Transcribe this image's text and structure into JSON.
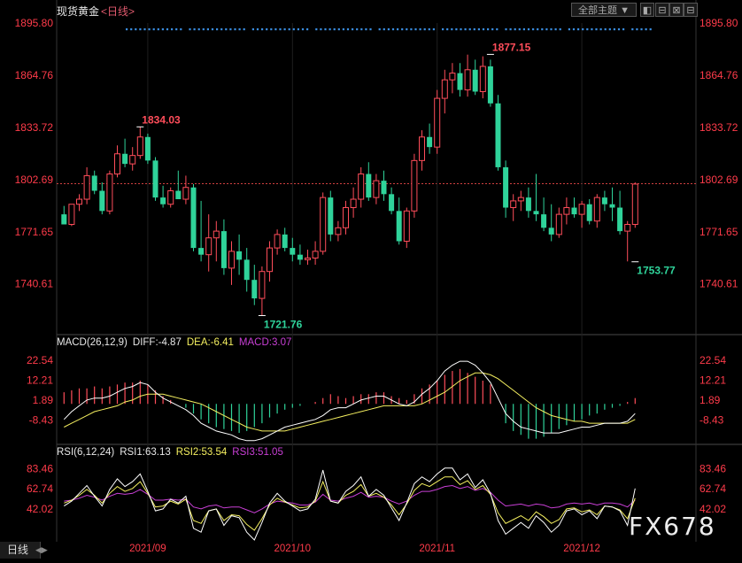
{
  "header": {
    "title": "现货黄金",
    "period": "<日线>",
    "theme_button": "全部主题",
    "theme_arrow": "▼",
    "window_buttons": [
      "◧",
      "⊟",
      "⊠",
      "⊟"
    ]
  },
  "bottom_tab": {
    "label": "日线",
    "arrows": "◀▶"
  },
  "watermark": "FX678",
  "colors": {
    "up": "#ff4d5a",
    "down": "#2fd39a",
    "axis": "#ff3b4a",
    "diff": "#ffffff",
    "dea": "#f5f060",
    "macd_legend": "#c93fd6",
    "rsi1": "#ffffff",
    "rsi2": "#f5f060",
    "rsi3": "#c93fd6",
    "dots": "#3a8de0"
  },
  "chart_data": [
    {
      "type": "candlestick",
      "title": "现货黄金",
      "y_ticks": [
        "1895.80",
        "1864.76",
        "1833.72",
        "1802.69",
        "1771.65",
        "1740.61"
      ],
      "ylim": [
        1711.5,
        1895.8
      ],
      "current_price_line": 1800.2,
      "x_ticks": [
        "2021/09",
        "2021/10",
        "2021/11",
        "2021/12"
      ],
      "x_tick_candle_index": [
        11,
        30,
        49,
        68
      ],
      "annotations": [
        {
          "text": "1834.03",
          "candle_index": 10,
          "value": 1834.03,
          "color": "up"
        },
        {
          "text": "1877.15",
          "candle_index": 56,
          "value": 1877.15,
          "color": "up"
        },
        {
          "text": "1721.76",
          "candle_index": 26,
          "value": 1721.76,
          "color": "down"
        },
        {
          "text": "1753.77",
          "candle_index": 75,
          "value": 1753.77,
          "color": "down"
        }
      ],
      "candles": [
        [
          1782,
          1787,
          1776,
          1776
        ],
        [
          1776,
          1788,
          1775,
          1788
        ],
        [
          1788,
          1794,
          1784,
          1791
        ],
        [
          1791,
          1810,
          1788,
          1805
        ],
        [
          1805,
          1808,
          1794,
          1796
        ],
        [
          1796,
          1801,
          1782,
          1784
        ],
        [
          1784,
          1808,
          1782,
          1806
        ],
        [
          1806,
          1823,
          1804,
          1818
        ],
        [
          1818,
          1827,
          1810,
          1812
        ],
        [
          1812,
          1822,
          1808,
          1817
        ],
        [
          1817,
          1834,
          1815,
          1828
        ],
        [
          1828,
          1830,
          1812,
          1814
        ],
        [
          1814,
          1816,
          1790,
          1792
        ],
        [
          1792,
          1799,
          1786,
          1788
        ],
        [
          1788,
          1798,
          1786,
          1796
        ],
        [
          1796,
          1808,
          1793,
          1791
        ],
        [
          1791,
          1805,
          1788,
          1798
        ],
        [
          1798,
          1800,
          1760,
          1762
        ],
        [
          1762,
          1790,
          1754,
          1758
        ],
        [
          1758,
          1782,
          1748,
          1768
        ],
        [
          1768,
          1778,
          1754,
          1772
        ],
        [
          1772,
          1779,
          1746,
          1750
        ],
        [
          1750,
          1766,
          1740,
          1760
        ],
        [
          1760,
          1770,
          1746,
          1755
        ],
        [
          1755,
          1762,
          1736,
          1743
        ],
        [
          1743,
          1752,
          1728,
          1732
        ],
        [
          1732,
          1751,
          1722,
          1748
        ],
        [
          1748,
          1766,
          1742,
          1762
        ],
        [
          1762,
          1773,
          1758,
          1770
        ],
        [
          1770,
          1774,
          1760,
          1762
        ],
        [
          1762,
          1768,
          1754,
          1758
        ],
        [
          1758,
          1764,
          1752,
          1755
        ],
        [
          1755,
          1761,
          1752,
          1756
        ],
        [
          1756,
          1766,
          1752,
          1760
        ],
        [
          1760,
          1795,
          1758,
          1792
        ],
        [
          1792,
          1796,
          1766,
          1770
        ],
        [
          1770,
          1778,
          1766,
          1774
        ],
        [
          1774,
          1790,
          1770,
          1786
        ],
        [
          1786,
          1798,
          1780,
          1791
        ],
        [
          1791,
          1810,
          1786,
          1806
        ],
        [
          1806,
          1813,
          1790,
          1792
        ],
        [
          1792,
          1806,
          1788,
          1802
        ],
        [
          1802,
          1808,
          1790,
          1794
        ],
        [
          1794,
          1798,
          1782,
          1784
        ],
        [
          1784,
          1792,
          1764,
          1766
        ],
        [
          1766,
          1786,
          1762,
          1784
        ],
        [
          1784,
          1818,
          1780,
          1814
        ],
        [
          1814,
          1832,
          1808,
          1828
        ],
        [
          1828,
          1836,
          1818,
          1822
        ],
        [
          1822,
          1856,
          1818,
          1851
        ],
        [
          1851,
          1868,
          1842,
          1862
        ],
        [
          1862,
          1872,
          1854,
          1866
        ],
        [
          1866,
          1872,
          1852,
          1856
        ],
        [
          1856,
          1877,
          1852,
          1868
        ],
        [
          1868,
          1874,
          1853,
          1855
        ],
        [
          1855,
          1876,
          1851,
          1870
        ],
        [
          1870,
          1874,
          1846,
          1848
        ],
        [
          1848,
          1853,
          1808,
          1810
        ],
        [
          1810,
          1814,
          1780,
          1786
        ],
        [
          1786,
          1794,
          1778,
          1790
        ],
        [
          1790,
          1796,
          1784,
          1792
        ],
        [
          1792,
          1798,
          1780,
          1784
        ],
        [
          1784,
          1806,
          1778,
          1782
        ],
        [
          1782,
          1792,
          1772,
          1774
        ],
        [
          1774,
          1788,
          1766,
          1770
        ],
        [
          1770,
          1786,
          1768,
          1782
        ],
        [
          1782,
          1792,
          1776,
          1786
        ],
        [
          1786,
          1792,
          1780,
          1782
        ],
        [
          1782,
          1790,
          1774,
          1788
        ],
        [
          1788,
          1791,
          1776,
          1778
        ],
        [
          1778,
          1794,
          1774,
          1792
        ],
        [
          1792,
          1796,
          1784,
          1788
        ],
        [
          1788,
          1798,
          1778,
          1786
        ],
        [
          1786,
          1796,
          1770,
          1772
        ],
        [
          1772,
          1778,
          1754,
          1776
        ],
        [
          1776,
          1801,
          1774,
          1800
        ]
      ],
      "dots_row_count": 117
    },
    {
      "type": "bar+line",
      "name": "MACD(26,12,9)",
      "legend": [
        "MACD(26,12,9)",
        "DIFF:-4.87",
        "DEA:-6.41",
        "MACD:3.07"
      ],
      "y_ticks": [
        "22.54",
        "12.21",
        "1.89",
        "-8.43"
      ],
      "ylim": [
        -20,
        28
      ],
      "macd": [
        6,
        7,
        8,
        8,
        9,
        8,
        9,
        10,
        11,
        11,
        12,
        10,
        7,
        4,
        2,
        0,
        -2,
        -5,
        -8,
        -10,
        -12,
        -13,
        -14,
        -15,
        -14,
        -12,
        -10,
        -7,
        -5,
        -3,
        -2,
        -1,
        0,
        1,
        3,
        5,
        4,
        3,
        4,
        5,
        5,
        6,
        6,
        4,
        3,
        2,
        5,
        8,
        10,
        12,
        15,
        17,
        18,
        16,
        14,
        12,
        10,
        0,
        -10,
        -14,
        -16,
        -18,
        -18,
        -17,
        -15,
        -13,
        -11,
        -9,
        -8,
        -6,
        -5,
        -3,
        -2,
        -1,
        1,
        3
      ],
      "diff": [
        -8,
        -4,
        -1,
        2,
        3,
        3,
        4,
        6,
        8,
        9,
        11,
        10,
        6,
        3,
        1,
        -1,
        -3,
        -6,
        -10,
        -12,
        -14,
        -15,
        -16,
        -18,
        -19,
        -19,
        -18,
        -16,
        -14,
        -12,
        -11,
        -10,
        -9,
        -8,
        -6,
        -3,
        -2,
        -2,
        0,
        2,
        3,
        4,
        4,
        2,
        0,
        -1,
        1,
        5,
        8,
        12,
        17,
        20,
        22,
        22,
        20,
        16,
        11,
        3,
        -5,
        -9,
        -12,
        -13,
        -14,
        -15,
        -15,
        -15,
        -14,
        -13,
        -12,
        -12,
        -11,
        -10,
        -10,
        -10,
        -9,
        -5
      ],
      "dea": [
        -12,
        -10,
        -8,
        -6,
        -4,
        -3,
        -2,
        -1,
        1,
        2,
        4,
        5,
        5,
        5,
        4,
        3,
        2,
        1,
        0,
        -2,
        -4,
        -6,
        -8,
        -10,
        -12,
        -13,
        -14,
        -14,
        -14,
        -14,
        -13,
        -12,
        -11,
        -10,
        -9,
        -8,
        -7,
        -6,
        -5,
        -4,
        -3,
        -2,
        -1,
        -1,
        -1,
        -1,
        -1,
        0,
        2,
        4,
        6,
        9,
        12,
        14,
        16,
        16,
        15,
        13,
        10,
        7,
        4,
        1,
        -2,
        -4,
        -6,
        -7,
        -8,
        -9,
        -9,
        -10,
        -10,
        -10,
        -10,
        -10,
        -10,
        -8
      ]
    },
    {
      "type": "line",
      "name": "RSI(6,12,24)",
      "legend": [
        "RSI(6,12,24)",
        "RSI1:63.13",
        "RSI2:53.54",
        "RSI3:51.05"
      ],
      "y_ticks": [
        "83.46",
        "62.74",
        "42.02"
      ],
      "ylim": [
        10,
        92
      ],
      "rsi1": [
        45,
        50,
        58,
        66,
        55,
        45,
        62,
        73,
        65,
        70,
        78,
        60,
        40,
        42,
        52,
        48,
        55,
        22,
        18,
        40,
        42,
        25,
        35,
        33,
        18,
        10,
        28,
        48,
        58,
        50,
        45,
        40,
        42,
        52,
        82,
        50,
        48,
        60,
        66,
        75,
        55,
        62,
        56,
        43,
        30,
        48,
        68,
        75,
        70,
        78,
        84,
        84,
        72,
        78,
        64,
        72,
        58,
        30,
        16,
        22,
        28,
        22,
        35,
        28,
        18,
        25,
        40,
        42,
        36,
        40,
        32,
        45,
        44,
        40,
        25,
        63
      ],
      "rsi2": [
        48,
        51,
        56,
        62,
        56,
        48,
        58,
        65,
        60,
        63,
        70,
        58,
        44,
        45,
        50,
        47,
        52,
        30,
        27,
        40,
        42,
        30,
        36,
        35,
        26,
        20,
        32,
        46,
        53,
        49,
        46,
        43,
        44,
        50,
        70,
        50,
        48,
        56,
        60,
        67,
        55,
        58,
        54,
        46,
        36,
        47,
        61,
        68,
        65,
        70,
        75,
        75,
        67,
        71,
        62,
        66,
        57,
        38,
        27,
        31,
        35,
        30,
        39,
        34,
        27,
        31,
        42,
        43,
        39,
        41,
        36,
        45,
        44,
        41,
        32,
        53
      ],
      "rsi3": [
        50,
        51,
        53,
        56,
        54,
        51,
        55,
        58,
        57,
        58,
        62,
        57,
        51,
        51,
        52,
        51,
        52,
        44,
        42,
        45,
        46,
        43,
        44,
        44,
        41,
        38,
        42,
        47,
        50,
        49,
        48,
        46,
        46,
        49,
        57,
        51,
        50,
        53,
        55,
        59,
        54,
        55,
        54,
        50,
        47,
        50,
        56,
        60,
        60,
        62,
        65,
        66,
        63,
        65,
        61,
        63,
        59,
        51,
        45,
        46,
        47,
        45,
        47,
        46,
        43,
        44,
        47,
        48,
        47,
        48,
        46,
        48,
        48,
        47,
        44,
        51
      ]
    }
  ]
}
